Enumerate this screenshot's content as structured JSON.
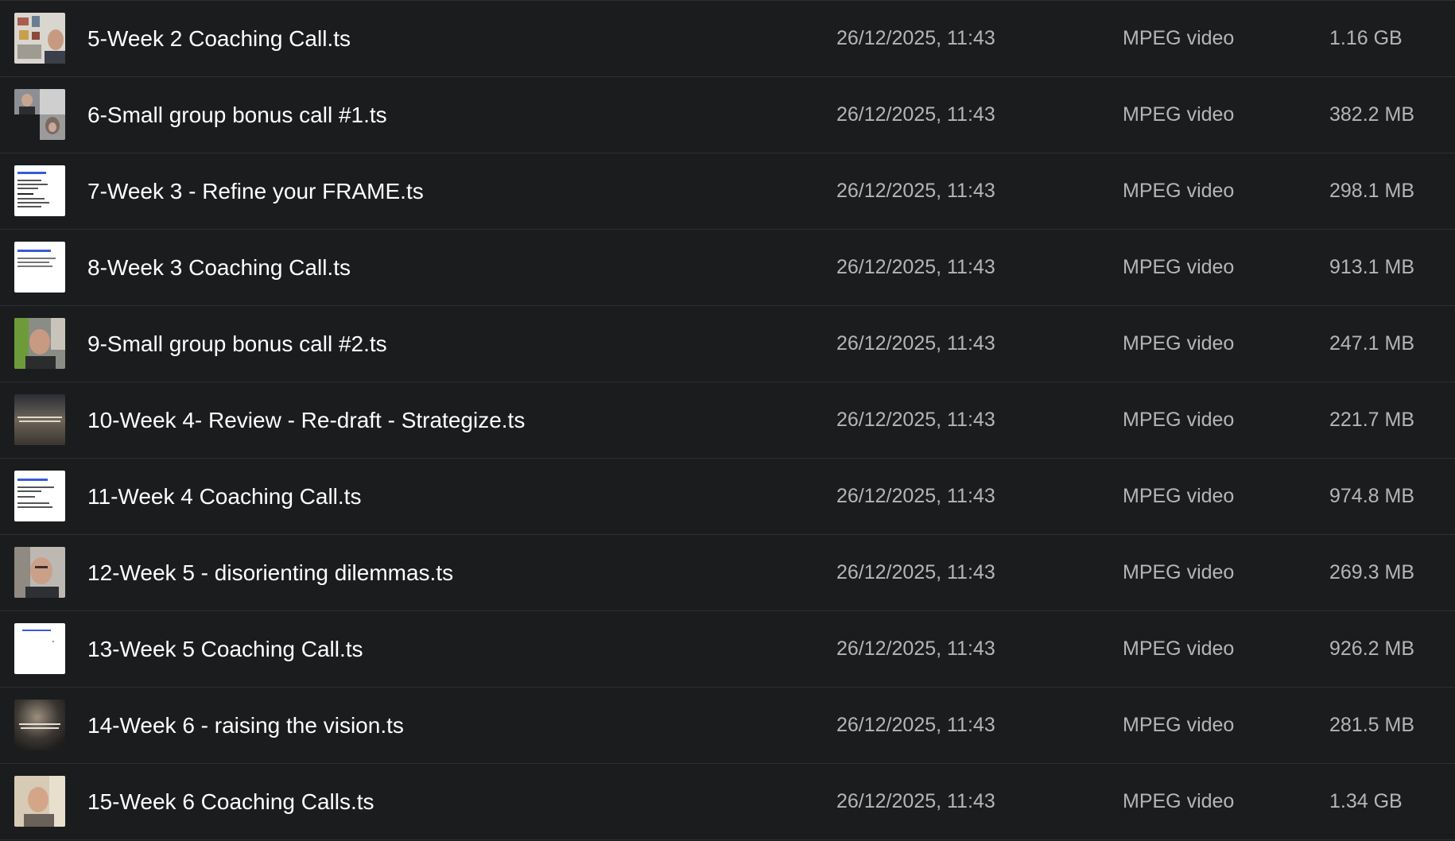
{
  "files": [
    {
      "name": "5-Week 2 Coaching Call.ts",
      "modified": "26/12/2025, 11:43",
      "kind": "MPEG video",
      "size": "1.16 GB",
      "thumbnail": "video-thumbnail-person"
    },
    {
      "name": "6-Small group bonus call #1.ts",
      "modified": "26/12/2025, 11:43",
      "kind": "MPEG video",
      "size": "382.2 MB",
      "thumbnail": "video-thumbnail-video-call"
    },
    {
      "name": "7-Week 3 - Refine your FRAME.ts",
      "modified": "26/12/2025, 11:43",
      "kind": "MPEG video",
      "size": "298.1 MB",
      "thumbnail": "video-thumbnail-slide"
    },
    {
      "name": "8-Week 3 Coaching Call.ts",
      "modified": "26/12/2025, 11:43",
      "kind": "MPEG video",
      "size": "913.1 MB",
      "thumbnail": "video-thumbnail-slide"
    },
    {
      "name": "9-Small group bonus call #2.ts",
      "modified": "26/12/2025, 11:43",
      "kind": "MPEG video",
      "size": "247.1 MB",
      "thumbnail": "video-thumbnail-person"
    },
    {
      "name": "10-Week 4- Review - Re-draft - Strategize.ts",
      "modified": "26/12/2025, 11:43",
      "kind": "MPEG video",
      "size": "221.7 MB",
      "thumbnail": "video-thumbnail-sky"
    },
    {
      "name": "11-Week 4 Coaching Call.ts",
      "modified": "26/12/2025, 11:43",
      "kind": "MPEG video",
      "size": "974.8 MB",
      "thumbnail": "video-thumbnail-slide"
    },
    {
      "name": "12-Week 5 - disorienting dilemmas.ts",
      "modified": "26/12/2025, 11:43",
      "kind": "MPEG video",
      "size": "269.3 MB",
      "thumbnail": "video-thumbnail-person"
    },
    {
      "name": "13-Week 5 Coaching Call.ts",
      "modified": "26/12/2025, 11:43",
      "kind": "MPEG video",
      "size": "926.2 MB",
      "thumbnail": "video-thumbnail-slide"
    },
    {
      "name": "14-Week 6 - raising the vision.ts",
      "modified": "26/12/2025, 11:43",
      "kind": "MPEG video",
      "size": "281.5 MB",
      "thumbnail": "video-thumbnail-sky"
    },
    {
      "name": "15-Week 6 Coaching Calls.ts",
      "modified": "26/12/2025, 11:43",
      "kind": "MPEG video",
      "size": "1.34 GB",
      "thumbnail": "video-thumbnail-person"
    }
  ],
  "colors": {
    "background": "#1b1c1d",
    "divider": "#2e2f31",
    "primary_text": "#ffffff",
    "secondary_text": "#b4b5b8",
    "slide_title": "#3a5bd9"
  }
}
